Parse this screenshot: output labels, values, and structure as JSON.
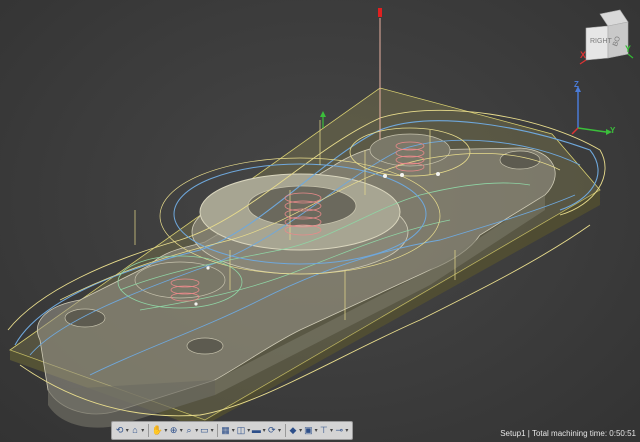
{
  "viewcube": {
    "face_right": "RIGHT",
    "face_top": "BO",
    "axis_x": "X",
    "axis_y": "Y"
  },
  "triad": {
    "z": "Z",
    "y": "Y"
  },
  "status": {
    "setup": "Setup1",
    "separator": "|",
    "machining_time": "Total machining time: 0:50:51"
  },
  "toolbar": {
    "buttons": [
      {
        "name": "orbit-icon",
        "glyph": "⟲"
      },
      {
        "name": "look-at-icon",
        "glyph": "⌂"
      },
      {
        "name": "pan-icon",
        "glyph": "✋"
      },
      {
        "name": "zoom-icon",
        "glyph": "⊕"
      },
      {
        "name": "fit-icon",
        "glyph": "⌕"
      },
      {
        "name": "display-settings-icon",
        "glyph": "▭"
      },
      {
        "name": "grid-icon",
        "glyph": "▦"
      },
      {
        "name": "viewports-icon",
        "glyph": "◫"
      },
      {
        "name": "stock-icon",
        "glyph": "▬"
      },
      {
        "name": "simulation-icon",
        "glyph": "⟳"
      },
      {
        "name": "toolpath-icon",
        "glyph": "◆"
      },
      {
        "name": "machine-icon",
        "glyph": "▣"
      },
      {
        "name": "tool-icon",
        "glyph": "⊤"
      },
      {
        "name": "tolerance-icon",
        "glyph": "⊸"
      }
    ]
  },
  "colors": {
    "background": "#3c3c3c",
    "stock": "#8c8750",
    "part": "#9a988a",
    "toolpath_blue": "#6fa8dc",
    "toolpath_yellow": "#e8dc8c",
    "toolpath_green": "#8fd4a4",
    "helix_red": "#e88a8a",
    "status_text": "#e6e6e6"
  }
}
